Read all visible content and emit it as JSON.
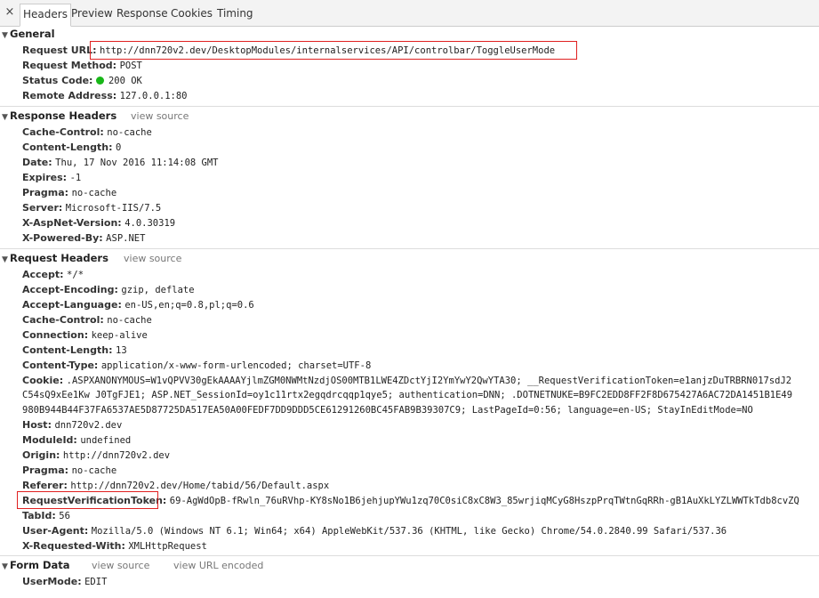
{
  "tabs": {
    "close": "×",
    "items": [
      "Headers",
      "Preview",
      "Response",
      "Cookies",
      "Timing"
    ],
    "active": "Headers"
  },
  "general": {
    "title": "General",
    "request_url_label": "Request URL:",
    "request_url": "http://dnn720v2.dev/DesktopModules/internalservices/API/controlbar/ToggleUserMode",
    "request_method_label": "Request Method:",
    "request_method": "POST",
    "status_code_label": "Status Code:",
    "status_code": "200 OK",
    "status_color": "#18b718",
    "remote_address_label": "Remote Address:",
    "remote_address": "127.0.0.1:80"
  },
  "response_headers": {
    "title": "Response Headers",
    "view_source": "view source",
    "items": [
      {
        "k": "Cache-Control:",
        "v": "no-cache"
      },
      {
        "k": "Content-Length:",
        "v": "0"
      },
      {
        "k": "Date:",
        "v": "Thu, 17 Nov 2016 11:14:08 GMT"
      },
      {
        "k": "Expires:",
        "v": "-1"
      },
      {
        "k": "Pragma:",
        "v": "no-cache"
      },
      {
        "k": "Server:",
        "v": "Microsoft-IIS/7.5"
      },
      {
        "k": "X-AspNet-Version:",
        "v": "4.0.30319"
      },
      {
        "k": "X-Powered-By:",
        "v": "ASP.NET"
      }
    ]
  },
  "request_headers": {
    "title": "Request Headers",
    "view_source": "view source",
    "items_before_cookie": [
      {
        "k": "Accept:",
        "v": "*/*"
      },
      {
        "k": "Accept-Encoding:",
        "v": "gzip, deflate"
      },
      {
        "k": "Accept-Language:",
        "v": "en-US,en;q=0.8,pl;q=0.6"
      },
      {
        "k": "Cache-Control:",
        "v": "no-cache"
      },
      {
        "k": "Connection:",
        "v": "keep-alive"
      },
      {
        "k": "Content-Length:",
        "v": "13"
      },
      {
        "k": "Content-Type:",
        "v": "application/x-www-form-urlencoded; charset=UTF-8"
      }
    ],
    "cookie_label": "Cookie:",
    "cookie_line1": ".ASPXANONYMOUS=W1vQPVV30gEkAAAAYjlmZGM0NWMtNzdjOS00MTB1LWE4ZDctYjI2YmYwY2QwYTA30; __RequestVerificationToken=e1anjzDuTRBRN017sdJ2",
    "cookie_line2": "C54sQ9xEe1Kw J0TgFJE1; ASP.NET_SessionId=oy1c11rtx2egqdrcqqp1qye5; authentication=DNN; .DOTNETNUKE=B9FC2EDD8FF2F8D675427A6AC72DA1451B1E49",
    "cookie_line3": "980B944B44F37FA6537AE5D87725DA517EA50A00FEDF7DD9DDD5CE61291260BC45FAB9B39307C9; LastPageId=0:56; language=en-US; StayInEditMode=NO",
    "items_after_cookie": [
      {
        "k": "Host:",
        "v": "dnn720v2.dev"
      },
      {
        "k": "ModuleId:",
        "v": "undefined"
      },
      {
        "k": "Origin:",
        "v": "http://dnn720v2.dev"
      },
      {
        "k": "Pragma:",
        "v": "no-cache"
      },
      {
        "k": "Referer:",
        "v": "http://dnn720v2.dev/Home/tabid/56/Default.aspx"
      }
    ],
    "token_label": "RequestVerificationToken:",
    "token_value": "69-AgWdOpB-fRwln_76uRVhp-KY8sNo1B6jehjupYWu1zq70C0siC8xC8W3_85wrjiqMCyG8HszpPrqTWtnGqRRh-gB1AuXkLYZLWWTkTdb8cvZQ",
    "items_after_token": [
      {
        "k": "TabId:",
        "v": "56"
      },
      {
        "k": "User-Agent:",
        "v": "Mozilla/5.0 (Windows NT 6.1; Win64; x64) AppleWebKit/537.36 (KHTML, like Gecko) Chrome/54.0.2840.99 Safari/537.36"
      },
      {
        "k": "X-Requested-With:",
        "v": "XMLHttpRequest"
      }
    ]
  },
  "form_data": {
    "title": "Form Data",
    "view_source": "view source",
    "view_url_encoded": "view URL encoded",
    "items": [
      {
        "k": "UserMode:",
        "v": "EDIT"
      }
    ]
  },
  "highlight_color": "#e02020"
}
